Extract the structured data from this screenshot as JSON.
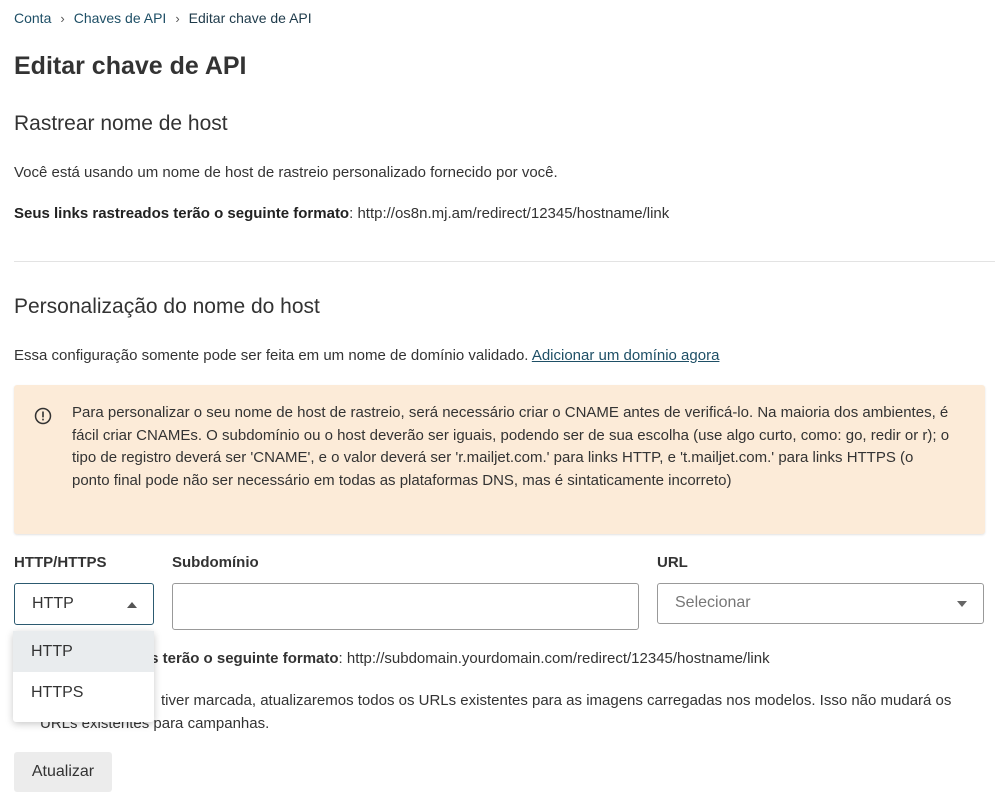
{
  "breadcrumb": {
    "items": [
      "Conta",
      "Chaves de API"
    ],
    "current": "Editar chave de API"
  },
  "page_title": "Editar chave de API",
  "tracking": {
    "heading": "Rastrear nome de host",
    "description": "Você está usando um nome de host de rastreio personalizado fornecido por você.",
    "format_label": "Seus links rastreados terão o seguinte formato",
    "format_value": ": http://os8n.mj.am/redirect/12345/hostname/link"
  },
  "customization": {
    "heading": "Personalização do nome do host",
    "description": "Essa configuração somente pode ser feita em um nome de domínio validado.",
    "add_domain_link": "Adicionar um domínio agora",
    "alert_text": "Para personalizar o seu nome de host de rastreio, será necessário criar o CNAME antes de verificá-lo. Na maioria dos ambientes, é fácil criar CNAMEs. O subdomínio ou o host deverão ser iguais, podendo ser de sua escolha (use algo curto, como: go, redir or r); o tipo de registro deverá ser 'CNAME', e o valor deverá ser 'r.mailjet.com.' para links HTTP, e 't.mailjet.com.' para links HTTPS (o ponto final pode não ser necessário em todas as plataformas DNS, mas é sintaticamente incorreto)"
  },
  "form": {
    "protocol_label": "HTTP/HTTPS",
    "protocol_value": "HTTP",
    "protocol_options": [
      "HTTP",
      "HTTPS"
    ],
    "subdomain_label": "Subdomínio",
    "subdomain_value": "",
    "url_label": "URL",
    "url_placeholder": "Selecionar",
    "format_label_visible": "os terão o seguinte formato",
    "format_value": ": http://subdomain.yourdomain.com/redirect/12345/hostname/link",
    "checkbox_text_visible": "tiver marcada, atualizaremos todos os URLs existentes para as imagens carregadas nos modelos. Isso não mudará os URLs existentes para campanhas.",
    "update_button": "Atualizar"
  },
  "colors": {
    "alert_bg": "#fcebd8",
    "link": "#1e4f66",
    "select_focus_border": "#2c5a70"
  }
}
